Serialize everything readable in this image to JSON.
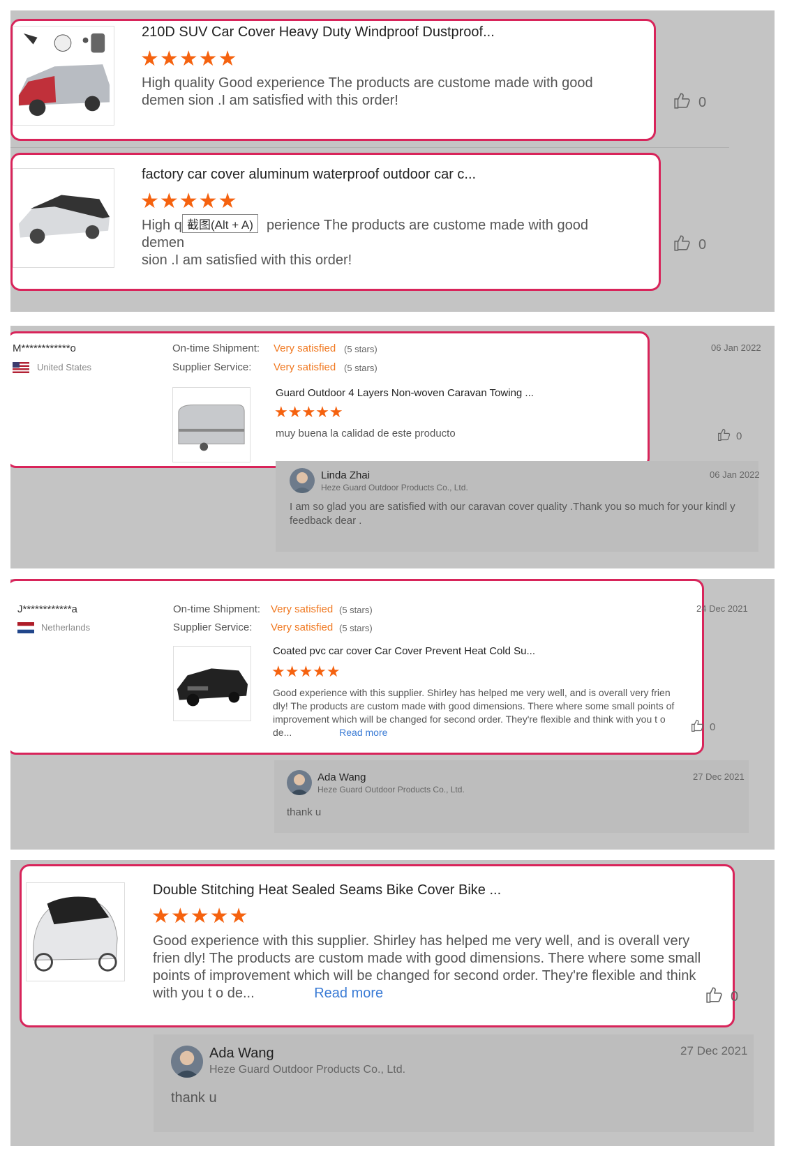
{
  "card1": {
    "title": "210D SUV Car Cover Heavy Duty Windproof Dustproof...",
    "stars": "★★★★★",
    "text": "High quality  Good experience The products  are custome made with good demen sion .I am satisfied with this order!",
    "likes": "0"
  },
  "card2": {
    "title": "factory car cover aluminum waterproof outdoor car c...",
    "stars": "★★★★★",
    "text_a": "High qu",
    "tooltip": "截图(Alt + A)",
    "text_b": "perience The products  are custome made with good demen",
    "text_c": "sion .I am satisfied with this order!",
    "likes": "0"
  },
  "review1": {
    "user": "M************o",
    "country": "United States",
    "date": "06 Jan 2022",
    "shipment_label": "On-time Shipment:",
    "shipment_value": "Very satisfied",
    "shipment_stars": "(5 stars)",
    "service_label": "Supplier Service:",
    "service_value": "Very satisfied",
    "service_stars": "(5 stars)",
    "product": "Guard Outdoor 4 Layers Non-woven Caravan Towing ...",
    "stars": "★★★★★",
    "text": "muy buena la calidad de este producto",
    "likes": "0",
    "reply": {
      "name": "Linda Zhai",
      "company": "Heze Guard Outdoor Products Co., Ltd.",
      "date": "06 Jan 2022",
      "text": "I am so glad you are satisfied with our caravan cover quality .Thank you so much for your kindl y feedback  dear ."
    }
  },
  "review2": {
    "user": "J************a",
    "country": "Netherlands",
    "date": "24 Dec 2021",
    "shipment_label": "On-time Shipment:",
    "shipment_value": "Very satisfied",
    "shipment_stars": "(5 stars)",
    "service_label": "Supplier Service:",
    "service_value": "Very satisfied",
    "service_stars": "(5 stars)",
    "product": "Coated pvc car cover Car Cover Prevent Heat Cold Su...",
    "stars": "★★★★★",
    "text": "Good experience with this supplier. Shirley has helped me very well, and is overall very frien dly! The products are custom made with good dimensions. There where some small points of improvement which will be changed for second order. They're flexible and think with you t o de...",
    "read_more": "Read more",
    "likes": "0",
    "reply": {
      "name": "Ada Wang",
      "company": "Heze Guard Outdoor Products Co., Ltd.",
      "date": "27 Dec 2021",
      "text": "thank u"
    }
  },
  "card5": {
    "title": "Double Stitching Heat Sealed Seams Bike Cover Bike ...",
    "stars": "★★★★★",
    "text": "Good experience with this supplier. Shirley has helped me very well, and is overall very frien dly! The products are custom made with good dimensions. There where some small points of improvement which will be changed for second order. They're flexible and think with you t o de...",
    "read_more": "Read more",
    "likes": "0",
    "reply": {
      "name": "Ada Wang",
      "company": "Heze Guard Outdoor Products Co., Ltd.",
      "date": "27 Dec 2021",
      "text": "thank u"
    }
  },
  "colors": {
    "highlight": "#d8245a",
    "star": "#f5620f",
    "link": "#3a7bd5",
    "panel": "#c4c4c4"
  }
}
